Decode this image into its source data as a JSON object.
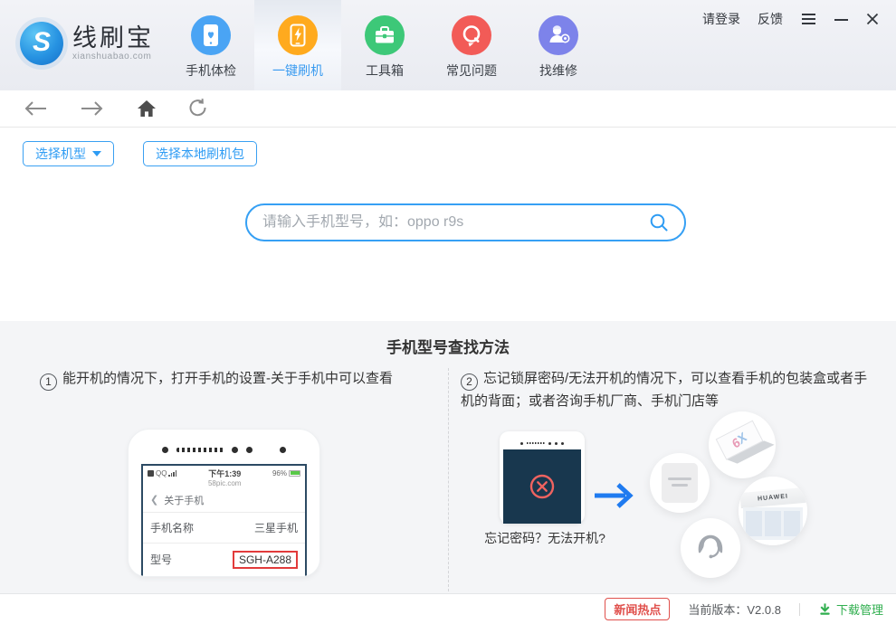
{
  "window": {
    "login": "请登录",
    "feedback": "反馈"
  },
  "logo": {
    "letter": "S",
    "title": "线刷宝",
    "subtitle": "xianshuabao.com"
  },
  "nav": {
    "items": [
      {
        "label": "手机体检",
        "icon": "phone-checkup-icon",
        "color": "#4aa4f4",
        "active": false
      },
      {
        "label": "一键刷机",
        "icon": "one-key-flash-icon",
        "color": "#ffaa1e",
        "active": true
      },
      {
        "label": "工具箱",
        "icon": "toolbox-icon",
        "color": "#3dc878",
        "active": false
      },
      {
        "label": "常见问题",
        "icon": "faq-icon",
        "color": "#f25b57",
        "active": false
      },
      {
        "label": "找维修",
        "icon": "repair-icon",
        "color": "#7d83ea",
        "active": false
      }
    ]
  },
  "actions": {
    "select_model": "选择机型",
    "select_local_package": "选择本地刷机包"
  },
  "search": {
    "placeholder": "请输入手机型号，如：oppo r9s",
    "value": ""
  },
  "guide": {
    "title": "手机型号查找方法",
    "step1": {
      "num": "1",
      "text": "能开机的情况下，打开手机的设置-关于手机中可以查看"
    },
    "step2": {
      "num": "2",
      "text": "忘记锁屏密码/无法开机的情况下，可以查看手机的包装盒或者手机的背面；或者咨询手机厂商、手机门店等"
    }
  },
  "phone_mock": {
    "carrier": "QQ",
    "time": "下午1:39",
    "site": "58pic.com",
    "battery": "96%",
    "back_title": "关于手机",
    "rows": [
      {
        "label": "手机名称",
        "value": "三星手机"
      },
      {
        "label": "型号",
        "value": "SGH-A288"
      }
    ]
  },
  "illustration": {
    "caption": "忘记密码？无法开机?",
    "box_label_num": "6",
    "box_label_letter": "X",
    "store_label": "HUAWEI"
  },
  "footer": {
    "news": "新闻热点",
    "version": "当前版本：V2.0.8",
    "download": "下载管理"
  },
  "colors": {
    "accent_blue": "#2e9cf4",
    "header_bg": "#eceef3",
    "panel_bg": "#f4f5f7",
    "news_red": "#e0504c",
    "download_green": "#2fae4e",
    "dark_screen": "#18374e",
    "error_red": "#ee6360"
  }
}
